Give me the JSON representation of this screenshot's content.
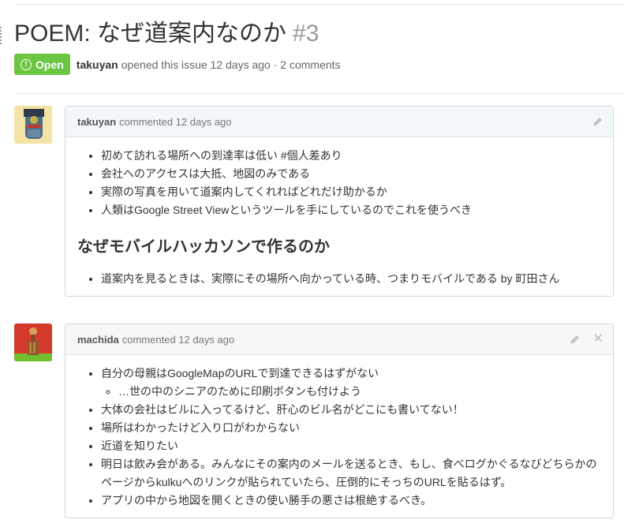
{
  "issue": {
    "title": "POEM: なぜ道案内なのか",
    "number": "#3",
    "state": "Open",
    "author": "takuyan",
    "meta_text": "opened this issue 12 days ago · 2 comments"
  },
  "comments": [
    {
      "author": "takuyan",
      "meta": "commented 12 days ago",
      "avatar_icon": "identicon-avatar",
      "list1": [
        "初めて訪れる場所への到達率は低い #個人差あり",
        "会社へのアクセスは大抵、地図のみである",
        "実際の写真を用いて道案内してくれればどれだけ助かるか",
        "人類はGoogle Street Viewというツールを手にしているのでこれを使うべき"
      ],
      "heading": "なぜモバイルハッカソンで作るのか",
      "list2": [
        "道案内を見るときは、実際にその場所へ向かっている時、つまりモバイルである by 町田さん"
      ]
    },
    {
      "author": "machida",
      "meta": "commented 12 days ago",
      "avatar_icon": "robot-avatar",
      "items": [
        "自分の母親はGoogleMapのURLで到達できるはずがない",
        "…世の中のシニアのために印刷ボタンも付けよう",
        "大体の会社はビルに入ってるけど、肝心のビル名がどこにも書いてない！",
        "場所はわかったけど入り口がわからない",
        "近道を知りたい",
        "明日は飲み会がある。みんなにその案内のメールを送るとき、もし、食べログかぐるなびどちらかのページからkulkuへのリンクが貼られていたら、圧倒的にそっちのURLを貼るはず。",
        "アプリの中から地図を開くときの使い勝手の悪さは根絶するべき。"
      ]
    }
  ],
  "colors": {
    "open_badge": "#6cc644",
    "header_blue": "#f2f8fa",
    "header_gray": "#f7f7f7"
  },
  "icons": {
    "edit": "pencil-icon",
    "delete": "close-icon",
    "state": "issue-opened-icon"
  }
}
